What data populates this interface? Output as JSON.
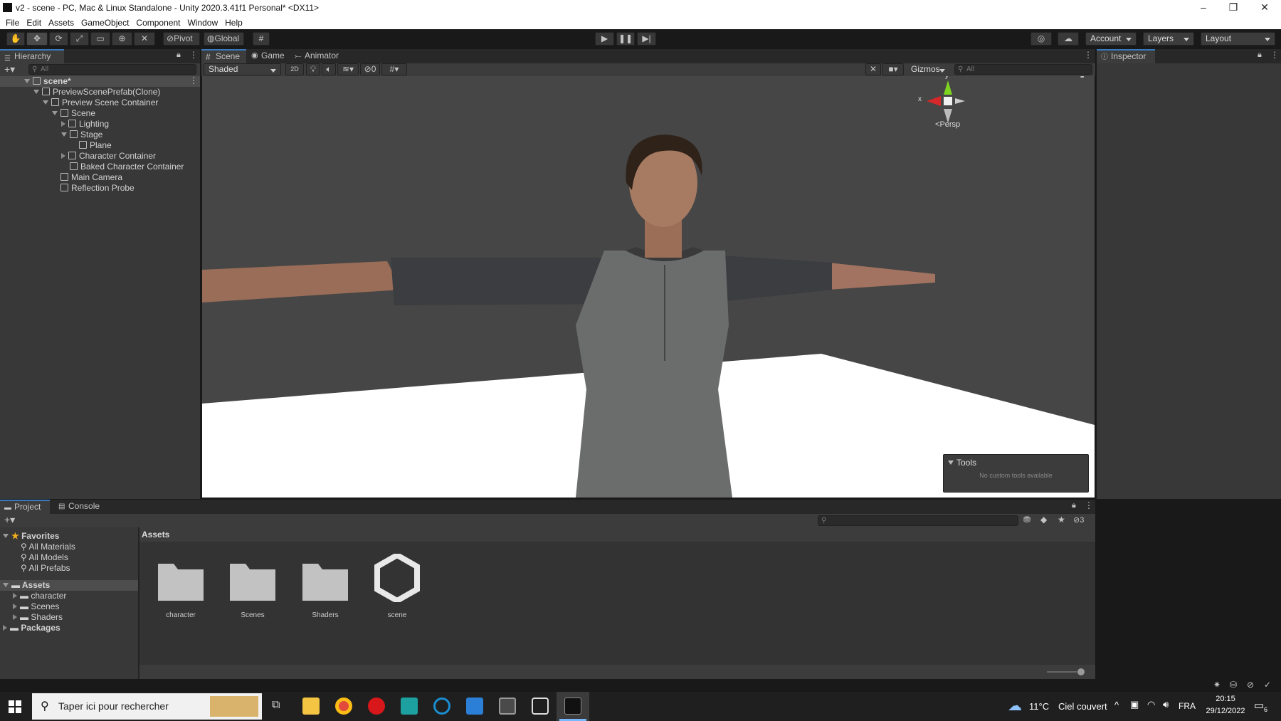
{
  "window": {
    "title": "v2 - scene - PC, Mac & Linux Standalone - Unity 2020.3.41f1 Personal* <DX11>",
    "controls": [
      "minimize-icon",
      "restore-icon",
      "close-icon"
    ]
  },
  "menu": [
    "File",
    "Edit",
    "Assets",
    "GameObject",
    "Component",
    "Window",
    "Help"
  ],
  "toolbar": {
    "tools": [
      "hand-tool-icon",
      "move-tool-icon",
      "rotate-tool-icon",
      "scale-tool-icon",
      "rect-tool-icon",
      "transform-tool-icon",
      "custom-tool-icon"
    ],
    "pivot_label": "Pivot",
    "global_label": "Global",
    "account_label": "Account",
    "layers_label": "Layers",
    "layout_label": "Layout"
  },
  "hierarchy": {
    "tab_label": "Hierarchy",
    "search_placeholder": "All",
    "items": [
      {
        "label": "scene*",
        "level": 0,
        "expand": "open",
        "icon": "scene-icon",
        "bold": true
      },
      {
        "label": "PreviewScenePrefab(Clone)",
        "level": 1,
        "expand": "open",
        "icon": "cube-icon"
      },
      {
        "label": "Preview Scene Container",
        "level": 2,
        "expand": "open",
        "icon": "cube-icon"
      },
      {
        "label": "Scene",
        "level": 3,
        "expand": "open",
        "icon": "cube-icon"
      },
      {
        "label": "Lighting",
        "level": 4,
        "expand": "closed",
        "icon": "cube-icon"
      },
      {
        "label": "Stage",
        "level": 4,
        "expand": "open",
        "icon": "cube-icon"
      },
      {
        "label": "Plane",
        "level": 5,
        "expand": "none",
        "icon": "cube-icon"
      },
      {
        "label": "Character Container",
        "level": 4,
        "expand": "closed",
        "icon": "cube-icon"
      },
      {
        "label": "Baked Character Container",
        "level": 4,
        "expand": "none",
        "icon": "cube-icon"
      },
      {
        "label": "Main Camera",
        "level": 3,
        "expand": "none",
        "icon": "cube-icon"
      },
      {
        "label": "Reflection Probe",
        "level": 3,
        "expand": "none",
        "icon": "cube-icon"
      }
    ]
  },
  "scene_tabs": [
    "Scene",
    "Game",
    "Animator"
  ],
  "scene_toolbar": {
    "shading": "Shaded",
    "mode_2d": "2D",
    "hidden_count": "0",
    "gizmos_label": "Gizmos",
    "search_placeholder": "All"
  },
  "gizmo": {
    "y_label": "y",
    "x_label": "x",
    "persp_label": "Persp"
  },
  "tools_overlay": {
    "title": "Tools",
    "message": "No custom tools available"
  },
  "inspector": {
    "tab_label": "Inspector"
  },
  "project": {
    "tabs": [
      "Project",
      "Console"
    ],
    "favorites_label": "Favorites",
    "favorites": [
      "All Materials",
      "All Models",
      "All Prefabs"
    ],
    "assets_label": "Assets",
    "asset_folders": [
      "character",
      "Scenes",
      "Shaders"
    ],
    "packages_label": "Packages",
    "breadcrumb": "Assets",
    "hidden_count": "3",
    "grid_items": [
      {
        "label": "character",
        "kind": "folder"
      },
      {
        "label": "Scenes",
        "kind": "folder"
      },
      {
        "label": "Shaders",
        "kind": "folder"
      },
      {
        "label": "scene",
        "kind": "unity-scene"
      }
    ]
  },
  "taskbar": {
    "search_placeholder": "Taper ici pour rechercher",
    "weather_temp": "11°C",
    "weather_text": "Ciel couvert",
    "language": "FRA",
    "time": "20:15",
    "date": "29/12/2022",
    "notification_count": "6"
  }
}
